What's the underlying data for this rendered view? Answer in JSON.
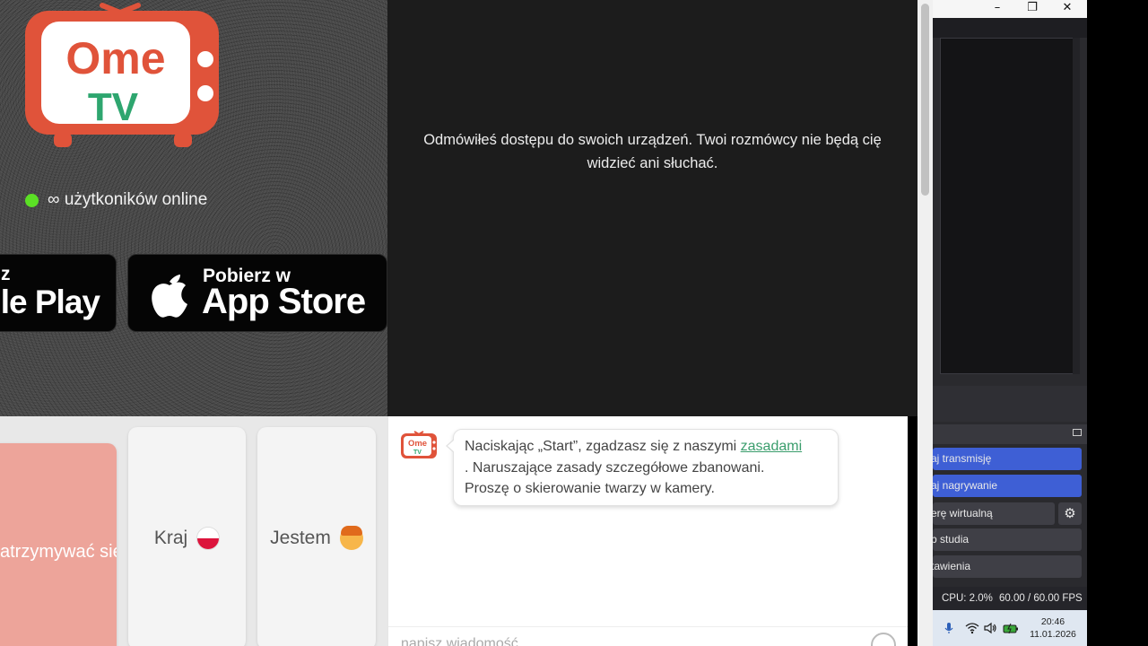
{
  "promo": {
    "logo_text_top": "Ome",
    "logo_text_bottom": "TV",
    "online_text": "∞ użytkoników online",
    "google_play": {
      "small": "z",
      "big": "gle Play"
    },
    "app_store": {
      "small": "Pobierz w",
      "big": "App Store"
    }
  },
  "video": {
    "message_line1": "Odmówiłeś dostępu do swoich urządzeń. Twoi rozmówcy nie będą cię",
    "message_line2": "widzieć ani słuchać."
  },
  "controls": {
    "start_label": "atrzymywać się",
    "country_label": "Kraj",
    "gender_label": "Jestem"
  },
  "chat": {
    "avatar_top": "Ome",
    "avatar_bottom": "TV",
    "bubble_prefix": "Naciskając „Start”, zgadzasz się z naszymi ",
    "bubble_link": "zasadami",
    "bubble_line2": ". Naruszające zasady szczegółowe zbanowani.",
    "bubble_line3": "Proszę o skierowanie twarzy w kamery.",
    "input_placeholder": "napisz wiadomość"
  },
  "obs": {
    "window_controls": {
      "minimize": "–",
      "maximize": "❐",
      "close": "✕"
    },
    "buttons": {
      "stream": "aj transmisję",
      "record": "aj nagrywanie",
      "virtual_cam": "erę wirtualną",
      "studio": "b studia",
      "settings": "tawienia"
    },
    "gear": "⚙",
    "cpu": "CPU: 2.0%",
    "fps": "60.00 / 60.00 FPS"
  },
  "tray": {
    "time": "20:46",
    "date": "11.01.2026"
  },
  "colors": {
    "logo_red": "#e0533a",
    "logo_green": "#2ea66f",
    "online_dot": "#5be025",
    "obs_blue": "#3e5fd5",
    "link_green": "#3a9d6c"
  }
}
